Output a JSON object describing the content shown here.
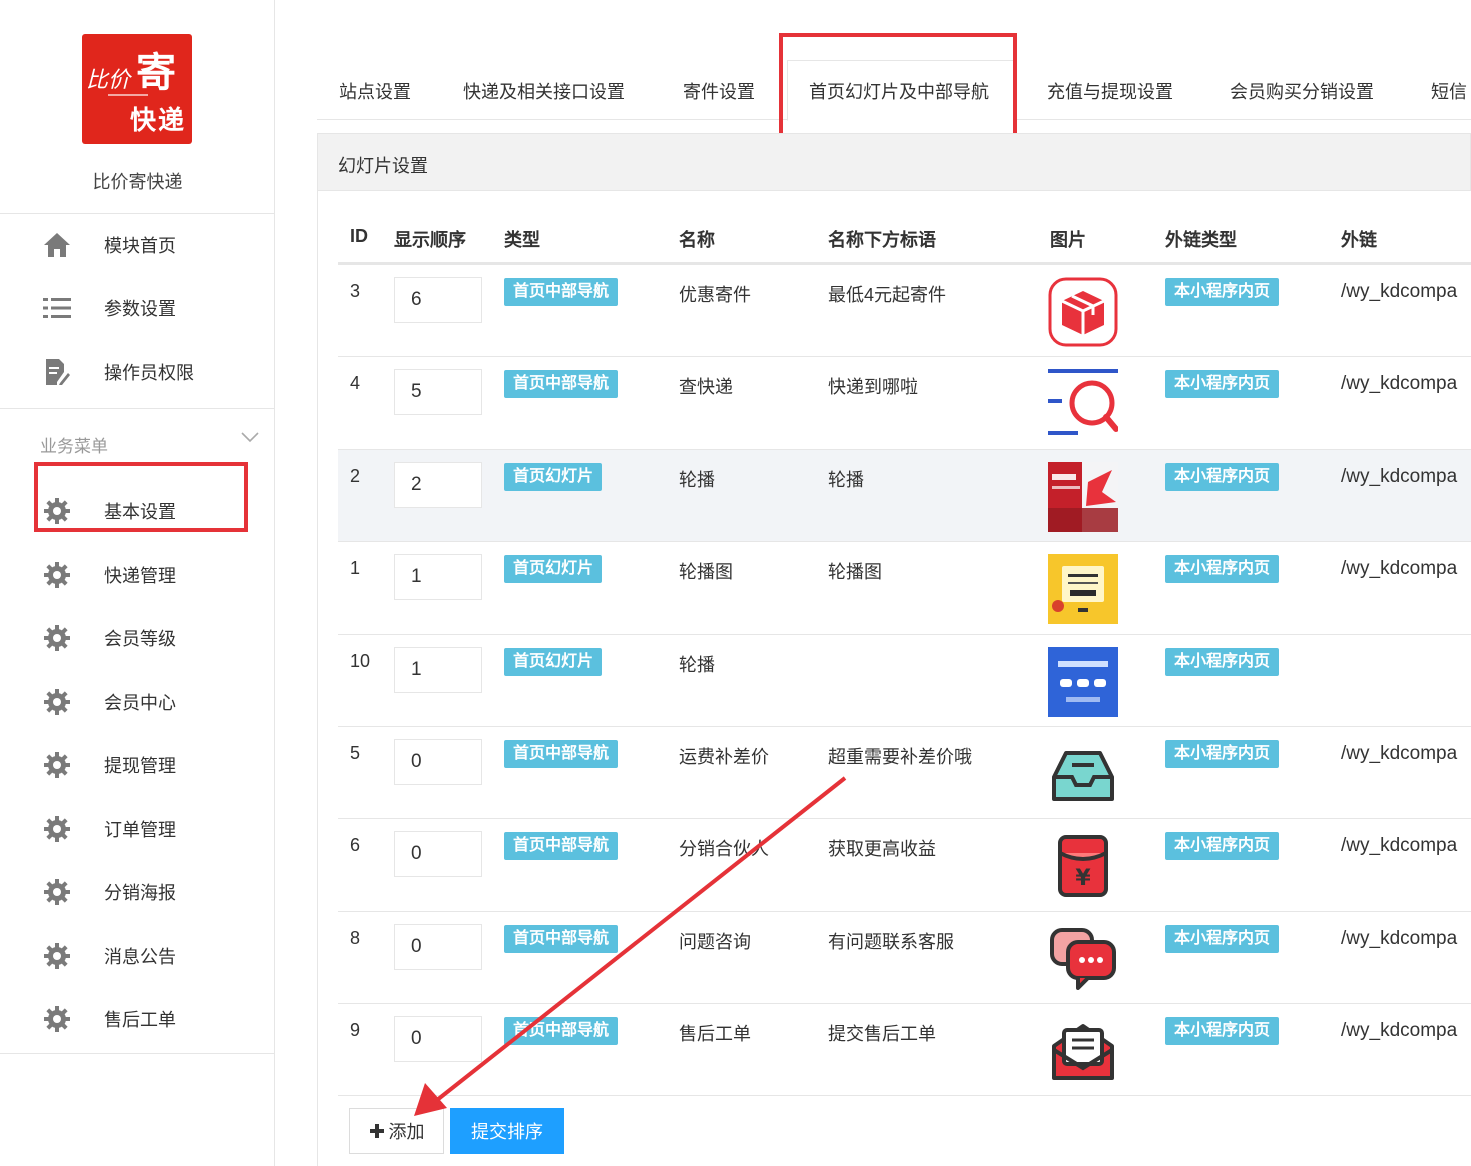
{
  "sidebar": {
    "logo": {
      "line1": "比价",
      "line2": "寄",
      "line3": "快递"
    },
    "site_name": "比价寄快递",
    "top_items": [
      {
        "label": "模块首页",
        "icon": "home-icon"
      },
      {
        "label": "参数设置",
        "icon": "list-icon"
      },
      {
        "label": "操作员权限",
        "icon": "file-edit-icon"
      }
    ],
    "group_title": "业务菜单",
    "business_items": [
      {
        "label": "基本设置",
        "icon": "gear-icon"
      },
      {
        "label": "快递管理",
        "icon": "gear-icon"
      },
      {
        "label": "会员等级",
        "icon": "gear-icon"
      },
      {
        "label": "会员中心",
        "icon": "gear-icon"
      },
      {
        "label": "提现管理",
        "icon": "gear-icon"
      },
      {
        "label": "订单管理",
        "icon": "gear-icon"
      },
      {
        "label": "分销海报",
        "icon": "gear-icon"
      },
      {
        "label": "消息公告",
        "icon": "gear-icon"
      },
      {
        "label": "售后工单",
        "icon": "gear-icon"
      }
    ]
  },
  "tabs": [
    "站点设置",
    "快递及相关接口设置",
    "寄件设置",
    "首页幻灯片及中部导航",
    "充值与提现设置",
    "会员购买分销设置",
    "短信"
  ],
  "active_tab": "首页幻灯片及中部导航",
  "panel": {
    "title": "幻灯片设置"
  },
  "table": {
    "columns": [
      "ID",
      "显示顺序",
      "类型",
      "名称",
      "名称下方标语",
      "图片",
      "外链类型",
      "外链"
    ],
    "rows": [
      {
        "id": "3",
        "order": "6",
        "type": "首页中部导航",
        "name": "优惠寄件",
        "slogan": "最低4元起寄件",
        "image": "parcel-box-icon",
        "link_type": "本小程序内页",
        "link": "/wy_kdcompa"
      },
      {
        "id": "4",
        "order": "5",
        "type": "首页中部导航",
        "name": "查快递",
        "slogan": "快递到哪啦",
        "image": "search-list-icon",
        "link_type": "本小程序内页",
        "link": "/wy_kdcompa"
      },
      {
        "id": "2",
        "order": "2",
        "type": "首页幻灯片",
        "name": "轮播",
        "slogan": "轮播",
        "image": "banner-flash-image",
        "link_type": "本小程序内页",
        "link": "/wy_kdcompa"
      },
      {
        "id": "1",
        "order": "1",
        "type": "首页幻灯片",
        "name": "轮播图",
        "slogan": "轮播图",
        "image": "banner-yellow-image",
        "link_type": "本小程序内页",
        "link": "/wy_kdcompa"
      },
      {
        "id": "10",
        "order": "1",
        "type": "首页幻灯片",
        "name": "轮播",
        "slogan": "",
        "image": "banner-blue-image",
        "link_type": "本小程序内页",
        "link": ""
      },
      {
        "id": "5",
        "order": "0",
        "type": "首页中部导航",
        "name": "运费补差价",
        "slogan": "超重需要补差价哦",
        "image": "inbox-tray-icon",
        "link_type": "本小程序内页",
        "link": "/wy_kdcompa"
      },
      {
        "id": "6",
        "order": "0",
        "type": "首页中部导航",
        "name": "分销合伙人",
        "slogan": "获取更高收益",
        "image": "red-envelope-icon",
        "link_type": "本小程序内页",
        "link": "/wy_kdcompa"
      },
      {
        "id": "8",
        "order": "0",
        "type": "首页中部导航",
        "name": "问题咨询",
        "slogan": "有问题联系客服",
        "image": "chat-bubbles-icon",
        "link_type": "本小程序内页",
        "link": "/wy_kdcompa"
      },
      {
        "id": "9",
        "order": "0",
        "type": "首页中部导航",
        "name": "售后工单",
        "slogan": "提交售后工单",
        "image": "mail-envelope-icon",
        "link_type": "本小程序内页",
        "link": "/wy_kdcompa"
      }
    ]
  },
  "actions": {
    "add_label": "添加",
    "add_icon": "plus-icon",
    "submit_label": "提交排序"
  },
  "colors": {
    "brand_red": "#e0261c",
    "badge_cyan": "#5bc0de",
    "primary_blue": "#1e9fff",
    "annotation_red": "#e53238"
  }
}
